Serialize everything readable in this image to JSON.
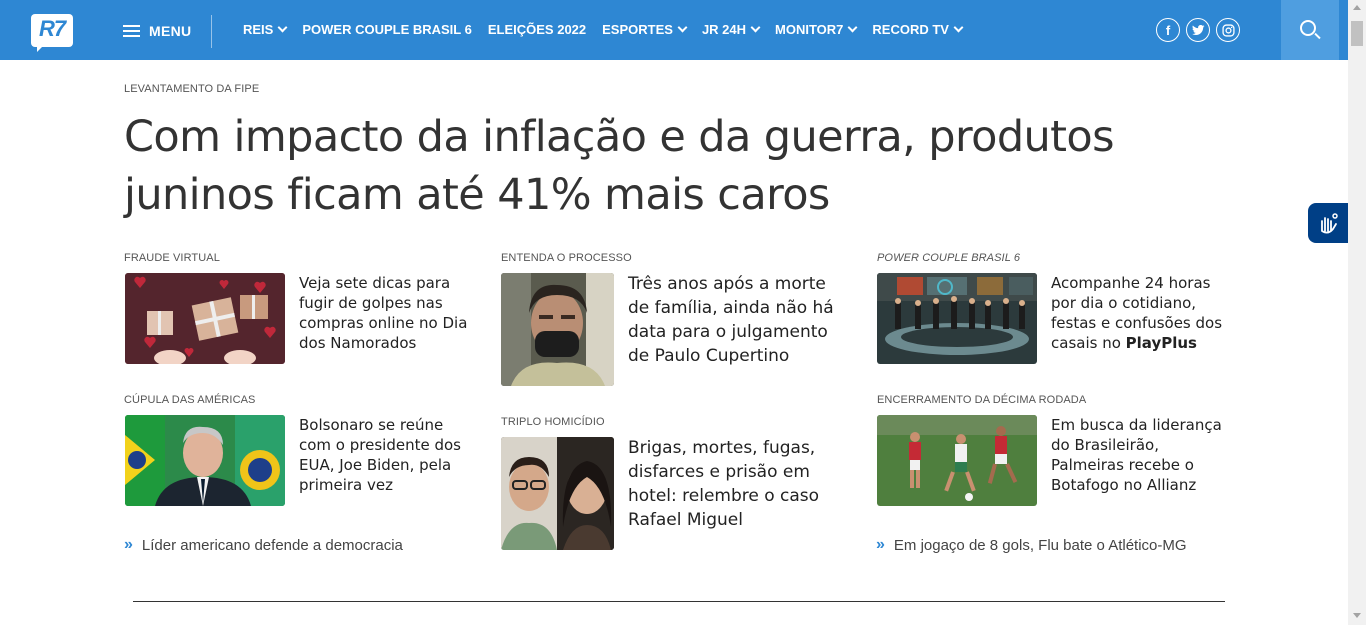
{
  "header": {
    "logo_text": "R7",
    "menu_label": "MENU",
    "nav": [
      {
        "label": "REIS",
        "has_dropdown": true
      },
      {
        "label": "POWER COUPLE BRASIL 6",
        "has_dropdown": false
      },
      {
        "label": "ELEIÇÕES 2022",
        "has_dropdown": false
      },
      {
        "label": "ESPORTES",
        "has_dropdown": true
      },
      {
        "label": "JR 24H",
        "has_dropdown": true
      },
      {
        "label": "MONITOR7",
        "has_dropdown": true
      },
      {
        "label": "RECORD TV",
        "has_dropdown": true
      }
    ],
    "social": {
      "facebook": "f",
      "twitter": "t",
      "instagram": "◎"
    },
    "brand_color": "#2e87d3"
  },
  "main": {
    "top_kicker": "LEVANTAMENTO DA FIPE",
    "headline_line1": "Com impacto da inflação e da guerra, produtos",
    "headline_line2": "juninos ficam até 41% mais caros",
    "cards": [
      {
        "kicker": "FRAUDE VIRTUAL",
        "title_lines": [
          "Veja sete dicas para",
          "fugir de golpes nas",
          "compras online no Dia",
          "dos Namorados"
        ],
        "thumb_icon": "gift-image"
      },
      {
        "kicker": "ENTENDA O PROCESSO",
        "title_lines": [
          "Três anos após a morte",
          "de família, ainda não há",
          "data para o julgamento",
          "de Paulo Cupertino"
        ],
        "thumb_icon": "man-mask-image"
      },
      {
        "kicker": "POWER COUPLE BRASIL 6",
        "title_lines": [
          "Acompanhe 24 horas",
          "por dia o cotidiano,",
          "festas e confusões dos",
          "casais no "
        ],
        "title_bold_suffix": "PlayPlus",
        "thumb_icon": "tv-studio-image"
      },
      {
        "kicker": "CÚPULA DAS AMÉRICAS",
        "title_lines": [
          "Bolsonaro se reúne",
          "com o presidente dos",
          "EUA, Joe Biden, pela",
          "primeira vez"
        ],
        "thumb_icon": "president-image"
      },
      {
        "kicker": "TRIPLO HOMICÍDIO",
        "title_lines": [
          "Brigas, mortes, fugas,",
          "disfarces e prisão em",
          "hotel: relembre o caso",
          "Rafael Miguel"
        ],
        "thumb_icon": "couple-image"
      },
      {
        "kicker": "ENCERRAMENTO DA DÉCIMA RODADA",
        "title_lines": [
          "Em busca da liderança",
          "do Brasileirão,",
          "Palmeiras recebe o",
          "Botafogo no Allianz"
        ],
        "thumb_icon": "soccer-image"
      }
    ],
    "related_links": [
      {
        "text": "Líder americano defende a democracia"
      },
      {
        "text": "Em jogaço de 8 gols, Flu bate o Atlético-MG"
      }
    ],
    "link_arrow": "»"
  }
}
